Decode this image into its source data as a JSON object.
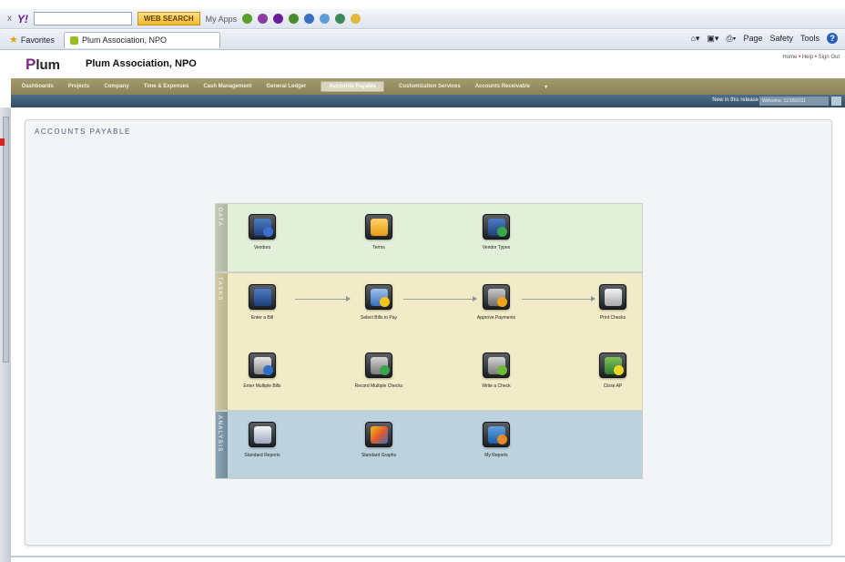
{
  "browser": {
    "close_glyph": "x",
    "yahoo_logo": "Y!",
    "search_value": "",
    "websearch_label": "WEB SEARCH",
    "my_apps_label": "My Apps",
    "favorites_label": "Favorites",
    "tab_title": "Plum Association, NPO",
    "page_menu": "Page",
    "safety_menu": "Safety",
    "tools_menu": "Tools"
  },
  "app": {
    "logo_letter": "P",
    "logo_text": "lum",
    "org_name": "Plum Association, NPO",
    "toplinks": [
      "Home",
      "Help",
      "Sign Out"
    ]
  },
  "nav": {
    "items": [
      "Dashboards",
      "Projects",
      "Company",
      "Time & Expenses",
      "Cash Management",
      "General Ledger",
      "Accounts Payable",
      "Customization Services",
      "Accounts Receivable"
    ],
    "active_index": 6
  },
  "subbar": {
    "new_label": "New in this release",
    "welcome_label": "Welcome, 11/18/2011"
  },
  "page": {
    "title": "Accounts Payable"
  },
  "sections": {
    "data": {
      "label": "Data",
      "tiles": [
        {
          "label": "Vendors",
          "icon": "vendors-icon"
        },
        {
          "label": "Terms",
          "icon": "terms-icon"
        },
        {
          "label": "Vendor Types",
          "icon": "vendor-types-icon"
        }
      ]
    },
    "tasks": {
      "label": "Tasks",
      "tiles": [
        {
          "label": "Enter a Bill",
          "icon": "enter-bill-icon"
        },
        {
          "label": "Select Bills to Pay",
          "icon": "select-bills-icon"
        },
        {
          "label": "Approve Payments",
          "icon": "approve-payments-icon"
        },
        {
          "label": "Print Checks",
          "icon": "print-checks-icon"
        },
        {
          "label": "Enter Multiple Bills",
          "icon": "enter-multiple-bills-icon"
        },
        {
          "label": "Record Multiple Checks",
          "icon": "record-multiple-checks-icon"
        },
        {
          "label": "Write a Check",
          "icon": "write-check-icon"
        },
        {
          "label": "Close AP",
          "icon": "close-ap-icon"
        }
      ]
    },
    "analysis": {
      "label": "Analysis",
      "tiles": [
        {
          "label": "Standard Reports",
          "icon": "standard-reports-icon"
        },
        {
          "label": "Standard Graphs",
          "icon": "standard-graphs-icon"
        },
        {
          "label": "My Reports",
          "icon": "my-reports-icon"
        }
      ]
    }
  },
  "colors": {
    "nav_bg": "#8f875d",
    "subbar_bg": "#3b5a70",
    "data_bg": "#e2efd9",
    "tasks_bg": "#f1ecc7",
    "analysis_bg": "#bcd2de",
    "brand_purple": "#7b2a86"
  }
}
